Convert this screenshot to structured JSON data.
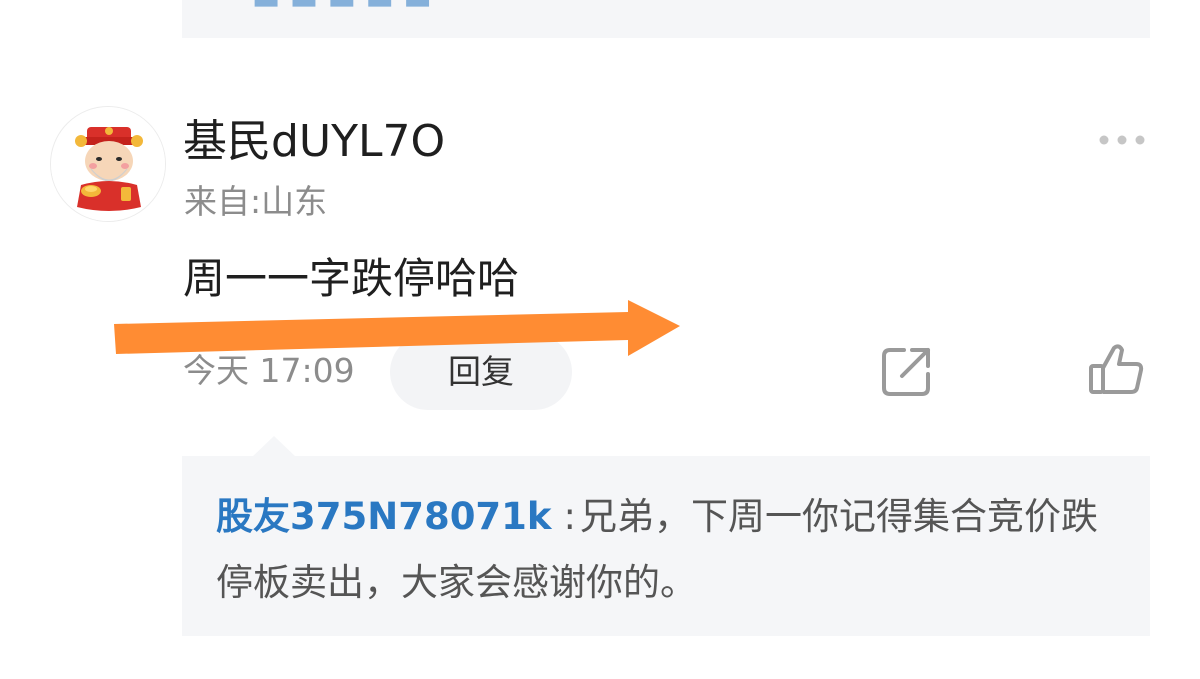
{
  "comment": {
    "username": "基民dUYL7O",
    "location": "来自:山东",
    "text": "周一一字跌停哈哈",
    "time": "今天 17:09",
    "reply_label": "回复"
  },
  "icons": {
    "more": "more-dots-icon",
    "share": "share-icon",
    "like": "thumbs-up-icon",
    "avatar": "avatar-image"
  },
  "reply": {
    "author": "股友375N78071k",
    "separator": ":",
    "text": "兄弟，下周一你记得集合竞价跌停板卖出，大家会感谢你的。"
  },
  "colors": {
    "link_blue": "#2a78c2",
    "annotation_orange": "#ff8c33",
    "card_bg": "#f5f6f8",
    "muted_text": "#8c8c8c"
  }
}
